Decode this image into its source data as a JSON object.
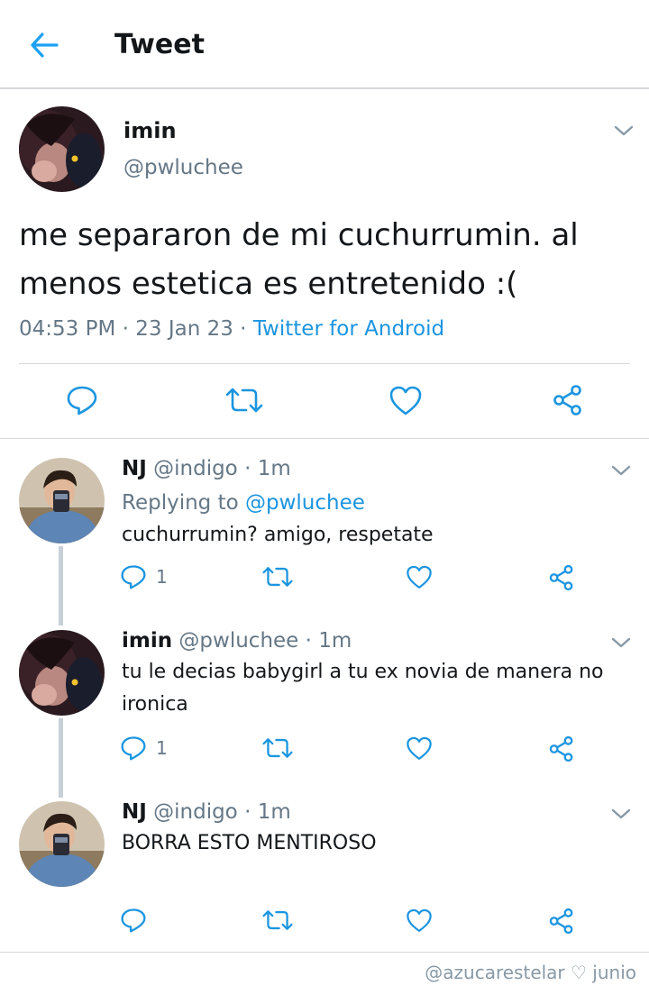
{
  "header": {
    "title": "Tweet",
    "back_icon": "arrow-left-icon",
    "accent": "#1da1f2"
  },
  "main_tweet": {
    "name": "imin",
    "handle": "@pwluchee",
    "text": "me separaron de mi cuchurrumin. al menos estetica es entretenido :(",
    "time": "04:53 PM",
    "date": "23 Jan 23",
    "source": "Twitter for Android",
    "sep1": " · ",
    "sep2": " · "
  },
  "replies": [
    {
      "name": "NJ",
      "handle": "@indigo",
      "time": "1m",
      "replying_prefix": "Replying to ",
      "replying_to": "@pwluchee",
      "text": "cuchurrumin? amigo, respetate",
      "reply_count": "1"
    },
    {
      "name": "imin",
      "handle": "@pwluchee",
      "time": "1m",
      "text": "tu le decias babygirl a tu ex novia de manera no ironica",
      "reply_count": "1"
    },
    {
      "name": "NJ",
      "handle": "@indigo",
      "time": "1m",
      "text": "BORRA ESTO MENTIROSO",
      "reply_count": ""
    }
  ],
  "watermark": "@azucarestelar ♡ junio",
  "colors": {
    "link": "#1b95e0",
    "muted": "#657786",
    "icon": "#1b95e0",
    "divider": "#d6d9dc"
  }
}
